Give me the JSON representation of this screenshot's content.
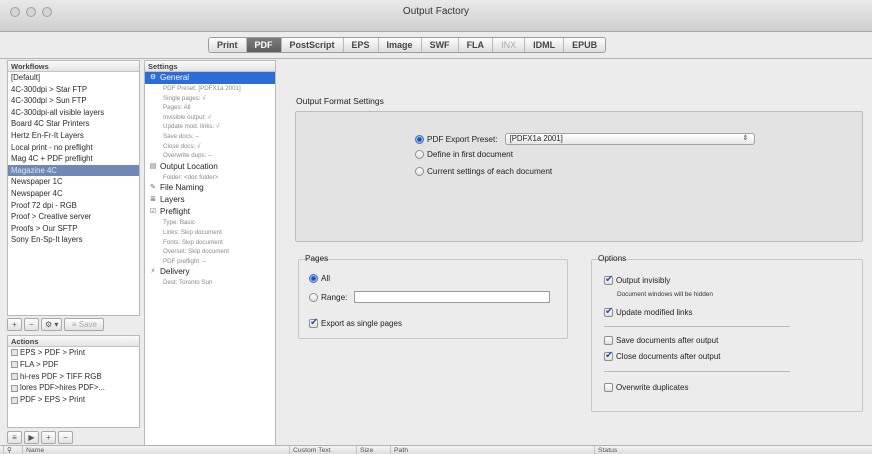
{
  "window": {
    "title": "Output Factory"
  },
  "tabs": [
    {
      "label": "Print",
      "state": "normal"
    },
    {
      "label": "PDF",
      "state": "active"
    },
    {
      "label": "PostScript",
      "state": "normal"
    },
    {
      "label": "EPS",
      "state": "normal"
    },
    {
      "label": "Image",
      "state": "normal"
    },
    {
      "label": "SWF",
      "state": "normal"
    },
    {
      "label": "FLA",
      "state": "normal"
    },
    {
      "label": "INX",
      "state": "disabled"
    },
    {
      "label": "IDML",
      "state": "normal"
    },
    {
      "label": "EPUB",
      "state": "normal"
    }
  ],
  "workflows": {
    "header": "Workflows",
    "items": [
      "[Default]",
      "4C-300dpi > Star FTP",
      "4C-300dpi > Sun FTP",
      "4C-300dpi-all visible layers",
      "Board 4C Star Printers",
      "Hertz En-Fr-It Layers",
      "Local print - no preflight",
      "Mag 4C + PDF preflight",
      "Magazine 4C",
      "Newspaper 1C",
      "Newspaper 4C",
      "Proof 72 dpi - RGB",
      "Proof > Creative server",
      "Proofs > Our SFTP",
      "Sony En-Sp-It layers"
    ],
    "selected_index": 8,
    "toolbar": {
      "add": "+",
      "remove": "−",
      "gear": "⚙ ▾",
      "save": "≡ Save"
    }
  },
  "actions": {
    "header": "Actions",
    "items": [
      "EPS > PDF > Print",
      "FLA > PDF",
      "hi-res PDF > TIFF RGB",
      "lores PDF>hires PDF>...",
      "PDF > EPS > Print"
    ],
    "toolbar": {
      "list": "≡",
      "play": "▶",
      "add": "+",
      "remove": "−"
    }
  },
  "settings": {
    "header": "Settings",
    "sections": [
      {
        "label": "General",
        "icon": "gear-icon",
        "glyph": "⚙",
        "selected": true,
        "subs": [
          "PDF Preset: [PDFX1a 2001]",
          "Single pages: √",
          "Pages: All",
          "Invisible output: √",
          "Update mod. links: √",
          "Save docs: –",
          "Close docs: √",
          "Overwrite dups: –"
        ]
      },
      {
        "label": "Output Location",
        "icon": "folder-icon",
        "glyph": "▤",
        "selected": false,
        "subs": [
          "Folder: <doc folder>"
        ]
      },
      {
        "label": "File Naming",
        "icon": "tag-icon",
        "glyph": "✎",
        "selected": false,
        "subs": []
      },
      {
        "label": "Layers",
        "icon": "layers-icon",
        "glyph": "≣",
        "selected": false,
        "subs": []
      },
      {
        "label": "Preflight",
        "icon": "checklist-icon",
        "glyph": "☑",
        "selected": false,
        "subs": [
          "Type: Basic",
          "Links: Skip document",
          "Fonts: Skip document",
          "Overset: Skip document",
          "PDF preflight: –"
        ]
      },
      {
        "label": "Delivery",
        "icon": "delivery-icon",
        "glyph": "⚡",
        "selected": false,
        "subs": [
          "Dest: Toronto Sun"
        ]
      }
    ]
  },
  "output_format": {
    "title": "Output Format Settings",
    "options": [
      {
        "label": "PDF Export Preset:",
        "selected": true
      },
      {
        "label": "Define in first document",
        "selected": false
      },
      {
        "label": "Current settings of each document",
        "selected": false
      }
    ],
    "preset_value": "[PDFX1a 2001]",
    "preset_arrow": "⇕"
  },
  "pages": {
    "title": "Pages",
    "all_label": "All",
    "all_selected": true,
    "range_label": "Range:",
    "range_value": "",
    "single_pages_label": "Export as single pages",
    "single_pages_checked": true
  },
  "options": {
    "title": "Options",
    "output_invisibly": {
      "label": "Output invisibly",
      "checked": true
    },
    "hint": "Document windows will be hidden",
    "update_links": {
      "label": "Update modified links",
      "checked": true
    },
    "save_docs": {
      "label": "Save documents after output",
      "checked": false
    },
    "close_docs": {
      "label": "Close documents after output",
      "checked": true
    },
    "overwrite": {
      "label": "Overwrite duplicates",
      "checked": false
    }
  },
  "file_list_columns": [
    "⚲",
    "Name",
    "Custom Text",
    "Size",
    "Path",
    "Status"
  ]
}
